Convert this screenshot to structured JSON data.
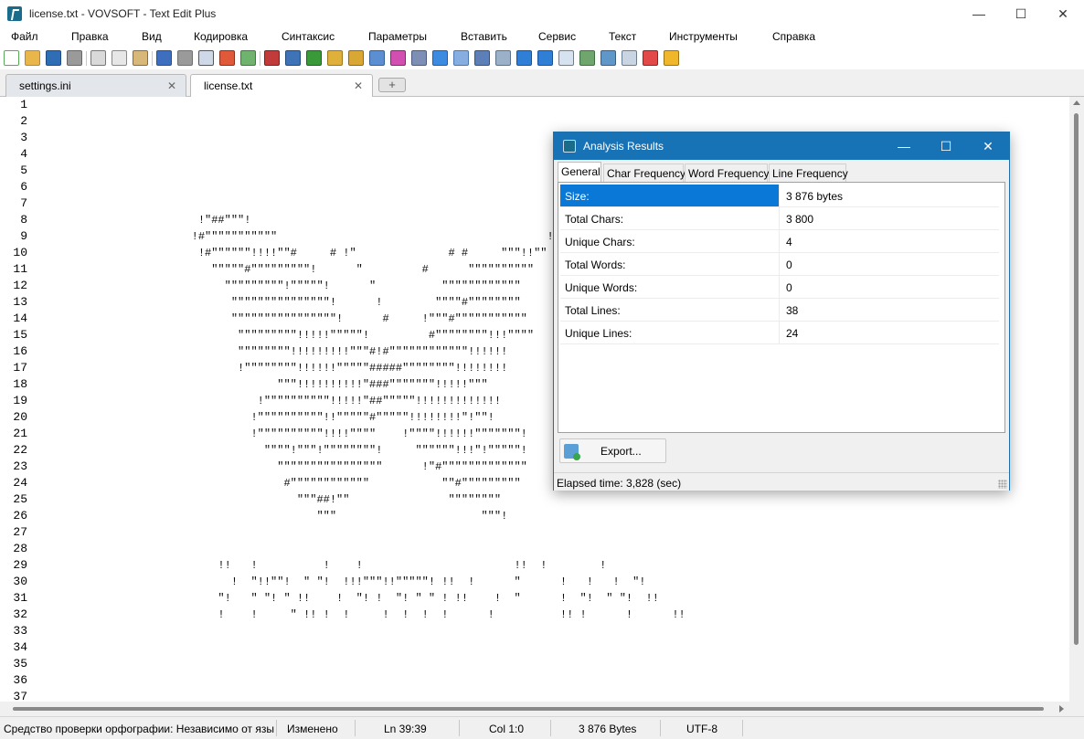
{
  "window": {
    "title": "license.txt - VOVSOFT - Text Edit Plus",
    "minimize_glyph": "—",
    "maximize_glyph": "☐",
    "close_glyph": "✕"
  },
  "menu": [
    "Файл",
    "Правка",
    "Вид",
    "Кодировка",
    "Синтаксис",
    "Параметры",
    "Вставить",
    "Сервис",
    "Текст",
    "Инструменты",
    "Справка"
  ],
  "toolbar_icons": [
    {
      "name": "new-file-icon",
      "color": "#ffffff",
      "border": "#5aa95a"
    },
    {
      "name": "open-folder-icon",
      "color": "#e8b64a",
      "border": "#b98a25"
    },
    {
      "name": "save-icon",
      "color": "#2f6db5",
      "border": "#1d4c85"
    },
    {
      "name": "print-icon",
      "color": "#9a9a9a",
      "border": "#666666"
    },
    {
      "name": "cut-icon",
      "color": "#d9d9d9",
      "border": "#777777"
    },
    {
      "name": "copy-icon",
      "color": "#e7e7e7",
      "border": "#888888"
    },
    {
      "name": "paste-icon",
      "color": "#d7b878",
      "border": "#8d6d2e"
    },
    {
      "name": "undo-icon",
      "color": "#3e6fbf",
      "border": "#2a4f8e"
    },
    {
      "name": "redo-icon",
      "color": "#9a9a9a",
      "border": "#707070"
    },
    {
      "name": "find-icon",
      "color": "#cfd8e6",
      "border": "#555555"
    },
    {
      "name": "replace-icon",
      "color": "#e05a3a",
      "border": "#8d2f1a"
    },
    {
      "name": "goto-icon",
      "color": "#6fb36f",
      "border": "#3d7a3d"
    },
    {
      "name": "book-icon",
      "color": "#c23b3b",
      "border": "#7d1f1f"
    },
    {
      "name": "monitor-icon",
      "color": "#3f73b8",
      "border": "#234a7d"
    },
    {
      "name": "spell-check-icon",
      "color": "#3a9a3a",
      "border": "#216021"
    },
    {
      "name": "lock-icon",
      "color": "#e0b13a",
      "border": "#9a7718"
    },
    {
      "name": "lock-alt-icon",
      "color": "#d9a733",
      "border": "#8f6c14"
    },
    {
      "name": "upload-icon",
      "color": "#5b8fd1",
      "border": "#345f96"
    },
    {
      "name": "color-wheel-icon",
      "color": "#d04fb0",
      "border": "#7f2a6b"
    },
    {
      "name": "pen-icon",
      "color": "#7d8fb5",
      "border": "#4c5b7c"
    },
    {
      "name": "filter-icon",
      "color": "#3d8be0",
      "border": "#225e9e"
    },
    {
      "name": "mail-icon",
      "color": "#86aee0",
      "border": "#4a77ad"
    },
    {
      "name": "list-icon",
      "color": "#5c7fb8",
      "border": "#37507d"
    },
    {
      "name": "keyboard-icon",
      "color": "#9bb0c9",
      "border": "#5f7189"
    },
    {
      "name": "arrow-right-icon",
      "color": "#2f7fd6",
      "border": "#1b5294"
    },
    {
      "name": "arrow-down-icon",
      "color": "#2f7fd6",
      "border": "#1b5294"
    },
    {
      "name": "window-copy-icon",
      "color": "#d6e2f0",
      "border": "#6a7f9a"
    },
    {
      "name": "sort-az-icon",
      "color": "#6ea66e",
      "border": "#3f6e3f"
    },
    {
      "name": "sort-za-icon",
      "color": "#5f98c8",
      "border": "#355f85"
    },
    {
      "name": "panel-icon",
      "color": "#c9d5e3",
      "border": "#6b7c91"
    },
    {
      "name": "calendar-icon",
      "color": "#e24a4a",
      "border": "#8f2424"
    },
    {
      "name": "warning-icon",
      "color": "#f0b72a",
      "border": "#9d7410"
    }
  ],
  "tabs": [
    {
      "label": "settings.ini",
      "close": "✕"
    },
    {
      "label": "license.txt",
      "close": "✕"
    }
  ],
  "tab_add_glyph": "+",
  "editor": {
    "line_numbers": [
      "1",
      "2",
      "3",
      "4",
      "5",
      "6",
      "7",
      "8",
      "9",
      "10",
      "11",
      "12",
      "13",
      "14",
      "15",
      "16",
      "17",
      "18",
      "19",
      "20",
      "21",
      "22",
      "23",
      "24",
      "25",
      "26",
      "27",
      "28",
      "29",
      "30",
      "31",
      "32",
      "33",
      "34",
      "35",
      "36",
      "37"
    ],
    "lines": [
      "",
      "",
      "",
      "",
      "",
      "",
      "",
      "                        !\"##\"\"\"!",
      "                       !#\"\"\"\"\"\"\"\"\"\"\"                                         !\"\"!\"",
      "                        !#\"\"\"\"\"\"!!!!\"\"#     # !\"              # #     \"\"\"!!\"\"",
      "                          \"\"\"\"\"#\"\"\"\"\"\"\"\"\"!      \"         #      \"\"\"\"\"\"\"\"\"\"",
      "                            \"\"\"\"\"\"\"\"\"!\"\"\"\"\"!      \"          \"\"\"\"\"\"\"\"\"\"\"\"",
      "                             \"\"\"\"\"\"\"\"\"\"\"\"\"\"\"!      !        \"\"\"\"#\"\"\"\"\"\"\"\"",
      "                             \"\"\"\"\"\"\"\"\"\"\"\"\"\"\"\"!      #     !\"\"\"#\"\"\"\"\"\"\"\"\"\"\"",
      "                              \"\"\"\"\"\"\"\"\"!!!!!\"\"\"\"\"!         #\"\"\"\"\"\"\"\"!!!\"\"\"\"",
      "                              \"\"\"\"\"\"\"\"!!!!!!!!!\"\"\"#!#\"\"\"\"\"\"\"\"\"\"\"\"!!!!!!",
      "                              !\"\"\"\"\"\"\"\"!!!!!!\"\"\"\"\"#####\"\"\"\"\"\"\"\"!!!!!!!!",
      "                                    \"\"\"!!!!!!!!!!\"###\"\"\"\"\"\"\"!!!!!\"\"\"",
      "                                 !\"\"\"\"\"\"\"\"\"\"!!!!!\"##\"\"\"\"\"!!!!!!!!!!!!!",
      "                                !\"\"\"\"\"\"\"\"\"\"!!\"\"\"\"\"#\"\"\"\"\"!!!!!!!!\"!\"\"!",
      "                                !\"\"\"\"\"\"\"\"\"\"!!!!\"\"\"\"    !\"\"\"\"!!!!!!\"\"\"\"\"\"\"!",
      "                                  \"\"\"\"!\"\"\"!\"\"\"\"\"\"\"\"!     \"\"\"\"\"\"!!!\"!\"\"\"\"\"!",
      "                                    \"\"\"\"\"\"\"\"\"\"\"\"\"\"\"\"      !\"#\"\"\"\"\"\"\"\"\"\"\"\"\"",
      "                                     #\"\"\"\"\"\"\"\"\"\"\"\"           \"\"#\"\"\"\"\"\"\"\"\"",
      "                                       \"\"\"##!\"\"               \"\"\"\"\"\"\"\"",
      "                                          \"\"\"                      \"\"\"!",
      "",
      "",
      "                           !!   !          !    !                       !!  !        !",
      "                             !  \"!!\"\"!  \" \"!  !!!\"\"\"!!\"\"\"\"\"! !!  !      \"      !   !   !  \"!",
      "                           \"!   \" \"! \" !!    !  \"! !  \"! \" \" ! !!    !  \"      !  \"!  \" \"!  !!",
      "                           !    !     \" !! !  !     !  !  !  !      !          !! !      !      !!",
      "",
      "",
      "",
      "",
      ""
    ]
  },
  "status": {
    "spell": "Средство проверки орфографии: Независимо от языка",
    "modified": "Изменено",
    "position": "Ln 39:39",
    "column": "Col 1:0",
    "size": "3 876 Bytes",
    "encoding": "UTF-8"
  },
  "dialog": {
    "title": "Analysis Results",
    "minimize_glyph": "—",
    "maximize_glyph": "☐",
    "close_glyph": "✕",
    "tabs": [
      "General",
      "Char Frequency",
      "Word Frequency",
      "Line Frequency"
    ],
    "rows": [
      {
        "label": "Size:",
        "value": "3 876 bytes"
      },
      {
        "label": "Total Chars:",
        "value": "3 800"
      },
      {
        "label": "Unique Chars:",
        "value": "4"
      },
      {
        "label": "Total Words:",
        "value": "0"
      },
      {
        "label": "Unique Words:",
        "value": "0"
      },
      {
        "label": "Total Lines:",
        "value": "38"
      },
      {
        "label": "Unique Lines:",
        "value": "24"
      }
    ],
    "export_label": "Export...",
    "elapsed": "Elapsed time: 3,828 (sec)"
  },
  "colors": {
    "accent": "#1873b6",
    "selection": "#0a78d7"
  }
}
